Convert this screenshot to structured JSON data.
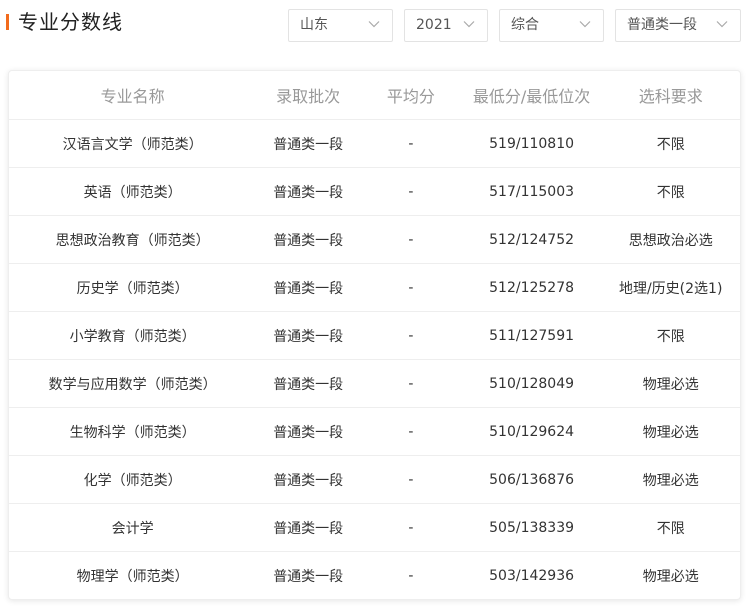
{
  "header": {
    "title": "专业分数线",
    "filters": [
      {
        "value": "山东"
      },
      {
        "value": "2021"
      },
      {
        "value": "综合"
      },
      {
        "value": "普通类一段"
      }
    ]
  },
  "table": {
    "columns": [
      "专业名称",
      "录取批次",
      "平均分",
      "最低分/最低位次",
      "选科要求"
    ],
    "rows": [
      {
        "major": "汉语言文学（师范类）",
        "batch": "普通类一段",
        "avg": "-",
        "min": "519/110810",
        "req": "不限"
      },
      {
        "major": "英语（师范类）",
        "batch": "普通类一段",
        "avg": "-",
        "min": "517/115003",
        "req": "不限"
      },
      {
        "major": "思想政治教育（师范类）",
        "batch": "普通类一段",
        "avg": "-",
        "min": "512/124752",
        "req": "思想政治必选"
      },
      {
        "major": "历史学（师范类）",
        "batch": "普通类一段",
        "avg": "-",
        "min": "512/125278",
        "req": "地理/历史(2选1)"
      },
      {
        "major": "小学教育（师范类）",
        "batch": "普通类一段",
        "avg": "-",
        "min": "511/127591",
        "req": "不限"
      },
      {
        "major": "数学与应用数学（师范类）",
        "batch": "普通类一段",
        "avg": "-",
        "min": "510/128049",
        "req": "物理必选"
      },
      {
        "major": "生物科学（师范类）",
        "batch": "普通类一段",
        "avg": "-",
        "min": "510/129624",
        "req": "物理必选"
      },
      {
        "major": "化学（师范类）",
        "batch": "普通类一段",
        "avg": "-",
        "min": "506/136876",
        "req": "物理必选"
      },
      {
        "major": "会计学",
        "batch": "普通类一段",
        "avg": "-",
        "min": "505/138339",
        "req": "不限"
      },
      {
        "major": "物理学（师范类）",
        "batch": "普通类一段",
        "avg": "-",
        "min": "503/142936",
        "req": "物理必选"
      }
    ]
  },
  "icons": {
    "dropdown": "chevron-down-icon"
  },
  "colors": {
    "accent": "#f26b1d"
  }
}
